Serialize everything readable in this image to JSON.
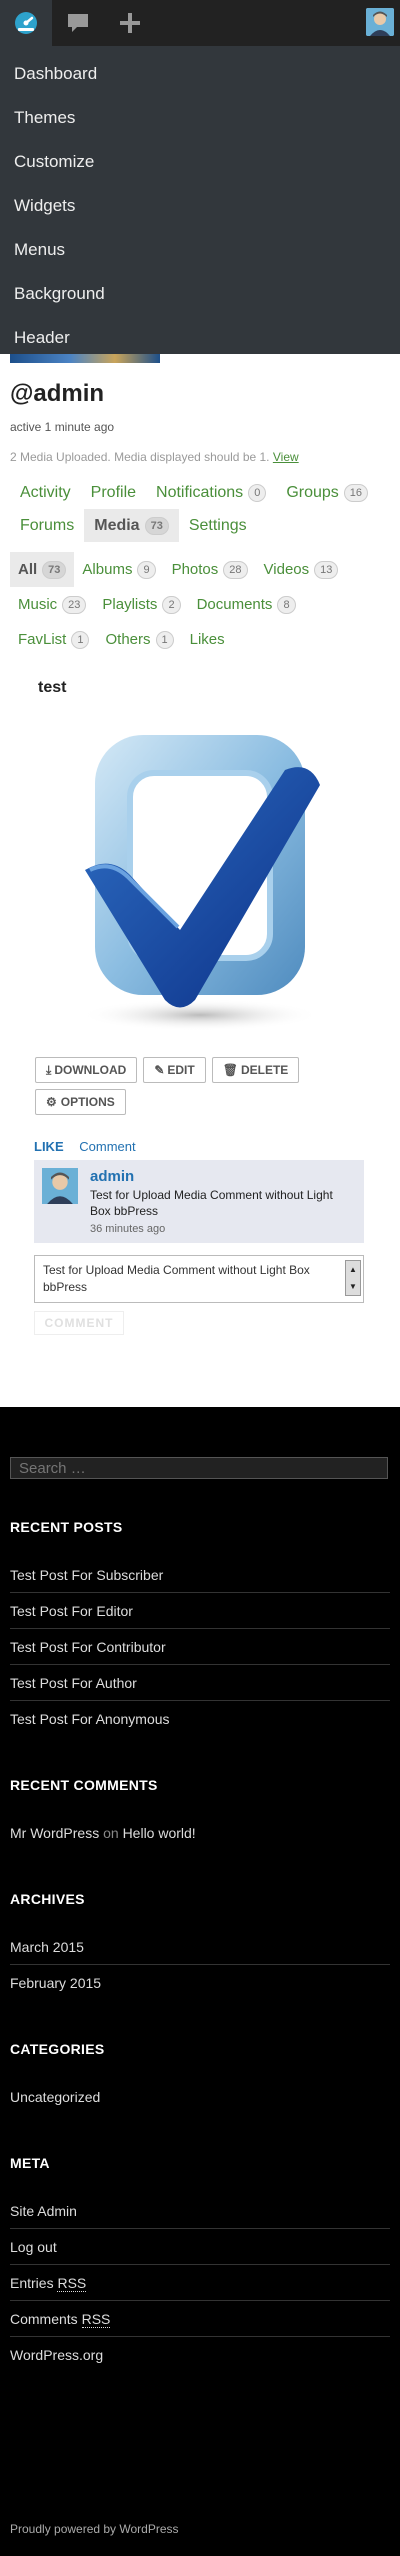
{
  "adminbar": {
    "items": [
      "dashboard-icon",
      "comments-icon",
      "new-content-icon"
    ]
  },
  "menu": {
    "items": [
      "Dashboard",
      "Themes",
      "Customize",
      "Widgets",
      "Menus",
      "Background",
      "Header"
    ]
  },
  "profile": {
    "username": "@admin",
    "activity": "active 1 minute ago",
    "notice": "2 Media Uploaded. Media displayed should be 1.",
    "notice_link": "View"
  },
  "nav": [
    {
      "label": "Activity"
    },
    {
      "label": "Profile"
    },
    {
      "label": "Notifications",
      "count": "0"
    },
    {
      "label": "Groups",
      "count": "16"
    },
    {
      "label": "Forums"
    },
    {
      "label": "Media",
      "count": "73",
      "current": true
    },
    {
      "label": "Settings"
    }
  ],
  "subnav": [
    {
      "label": "All",
      "count": "73",
      "current": true
    },
    {
      "label": "Albums",
      "count": "9"
    },
    {
      "label": "Photos",
      "count": "28"
    },
    {
      "label": "Videos",
      "count": "13"
    },
    {
      "label": "Music",
      "count": "23"
    },
    {
      "label": "Playlists",
      "count": "2"
    },
    {
      "label": "Documents",
      "count": "8"
    },
    {
      "label": "FavList",
      "count": "1"
    },
    {
      "label": "Others",
      "count": "1"
    },
    {
      "label": "Likes"
    }
  ],
  "media": {
    "title": "test",
    "buttons": {
      "download": "DOWNLOAD",
      "edit": "EDIT",
      "delete": "DELETE",
      "options": "OPTIONS"
    },
    "like": "LIKE",
    "comment_link": "Comment"
  },
  "comment": {
    "author": "admin",
    "text": "Test for Upload Media Comment without Light Box bbPress",
    "time": "36 minutes ago",
    "input_value": "Test for Upload Media Comment without Light Box bbPress",
    "submit": "COMMENT"
  },
  "sidebar": {
    "search_placeholder": "Search …",
    "recent_posts_title": "Recent Posts",
    "recent_posts": [
      "Test Post For Subscriber",
      "Test Post For Editor",
      "Test Post For Contributor",
      "Test Post For Author",
      "Test Post For Anonymous"
    ],
    "recent_comments_title": "Recent Comments",
    "recent_comment_author": "Mr WordPress",
    "recent_comment_on": "on",
    "recent_comment_post": "Hello world!",
    "archives_title": "Archives",
    "archives": [
      "March 2015",
      "February 2015"
    ],
    "categories_title": "Categories",
    "categories": [
      "Uncategorized"
    ],
    "meta_title": "Meta",
    "meta": {
      "site_admin": "Site Admin",
      "log_out": "Log out",
      "entries_prefix": "Entries",
      "entries_abbr": "RSS",
      "comments_prefix": "Comments",
      "comments_abbr": "RSS",
      "wordpress_org": "WordPress.org"
    },
    "powered": "Proudly powered by WordPress"
  }
}
